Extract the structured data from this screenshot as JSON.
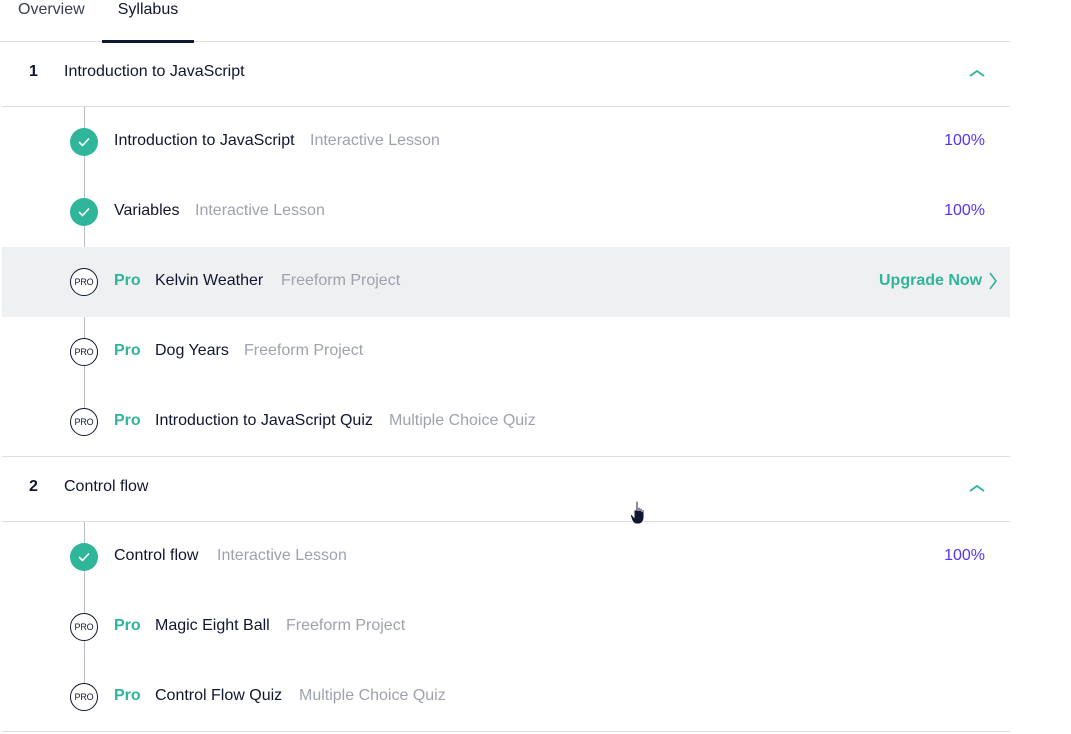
{
  "tabs": [
    {
      "label": "Overview",
      "active": false
    },
    {
      "label": "Syllabus",
      "active": true
    }
  ],
  "colors": {
    "accent": "#2eb59a",
    "percent": "#5533ff",
    "text": "#10162f",
    "muted": "#9ea2ad",
    "highlight_row": "#eff0f2"
  },
  "sections": [
    {
      "number": "1",
      "title": "Introduction to JavaScript",
      "expanded": true,
      "items": [
        {
          "status": "completed",
          "title": "Introduction to JavaScript",
          "type": "Interactive Lesson",
          "progress": "100%"
        },
        {
          "status": "completed",
          "title": "Variables",
          "type": "Interactive Lesson",
          "progress": "100%"
        },
        {
          "status": "pro",
          "badge": "PRO",
          "pro_label": "Pro",
          "title": "Kelvin Weather",
          "type": "Freeform Project",
          "action": "Upgrade Now",
          "hovered": true
        },
        {
          "status": "pro",
          "badge": "PRO",
          "pro_label": "Pro",
          "title": "Dog Years",
          "type": "Freeform Project"
        },
        {
          "status": "pro",
          "badge": "PRO",
          "pro_label": "Pro",
          "title": "Introduction to JavaScript Quiz",
          "type": "Multiple Choice Quiz"
        }
      ]
    },
    {
      "number": "2",
      "title": "Control flow",
      "expanded": true,
      "items": [
        {
          "status": "completed",
          "title": "Control flow",
          "type": "Interactive Lesson",
          "progress": "100%"
        },
        {
          "status": "pro",
          "badge": "PRO",
          "pro_label": "Pro",
          "title": "Magic Eight Ball",
          "type": "Freeform Project"
        },
        {
          "status": "pro",
          "badge": "PRO",
          "pro_label": "Pro",
          "title": "Control Flow Quiz",
          "type": "Multiple Choice Quiz"
        }
      ]
    }
  ],
  "icons": {
    "completed": "check-circle-icon",
    "pro": "pro-badge-icon",
    "collapse": "chevron-up-icon",
    "upgrade": "chevron-right-icon",
    "cursor": "hand-pointer-icon"
  }
}
